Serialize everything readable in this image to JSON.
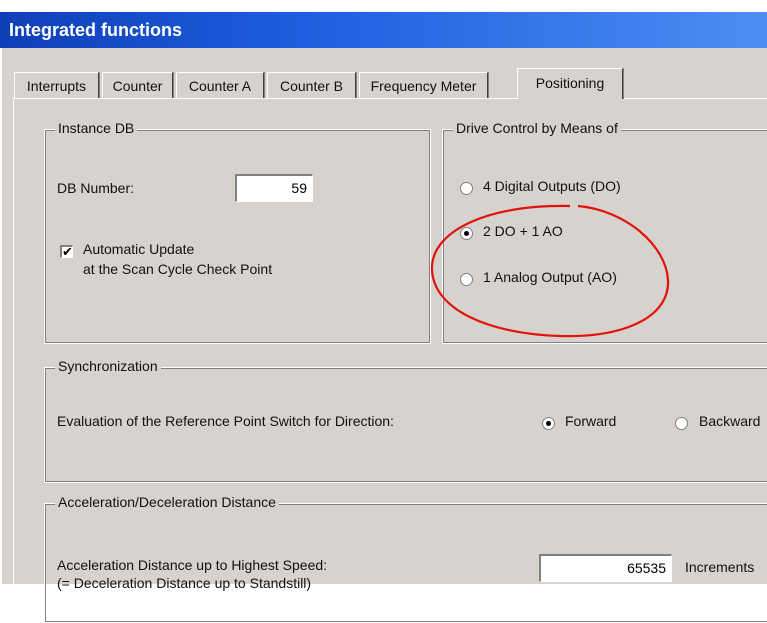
{
  "window": {
    "title": "Integrated functions"
  },
  "tabs": [
    {
      "label": "Interrupts"
    },
    {
      "label": "Counter"
    },
    {
      "label": "Counter A"
    },
    {
      "label": "Counter B"
    },
    {
      "label": "Frequency Meter"
    },
    {
      "label": "Positioning"
    }
  ],
  "active_tab": "Positioning",
  "instance_db": {
    "title": "Instance DB",
    "db_number_label": "DB Number:",
    "db_number_value": "59",
    "auto_update_checked": true,
    "auto_update_label_line1": "Automatic Update",
    "auto_update_label_line2": "at the Scan Cycle Check Point"
  },
  "drive_control": {
    "title": "Drive Control by Means of",
    "options": [
      {
        "label": "4 Digital Outputs (DO)",
        "checked": false
      },
      {
        "label": "2 DO + 1 AO",
        "checked": true
      },
      {
        "label": "1 Analog Output (AO)",
        "checked": false
      }
    ]
  },
  "synchronization": {
    "title": "Synchronization",
    "eval_label": "Evaluation of the Reference Point Switch for Direction:",
    "forward_label": "Forward",
    "forward_checked": true,
    "backward_label": "Backward",
    "backward_checked": false
  },
  "acceleration": {
    "title": "Acceleration/Deceleration Distance",
    "distance_label_line1": "Acceleration Distance up to Highest Speed:",
    "distance_label_line2": "(= Deceleration Distance up to Standstill)",
    "distance_value": "65535",
    "unit_label": "Increments"
  },
  "colors": {
    "titlebar_start": "#0f3fb8",
    "titlebar_end": "#4d8df2",
    "dialog_bg": "#d6d3ce",
    "annotation": "#e3120b"
  }
}
